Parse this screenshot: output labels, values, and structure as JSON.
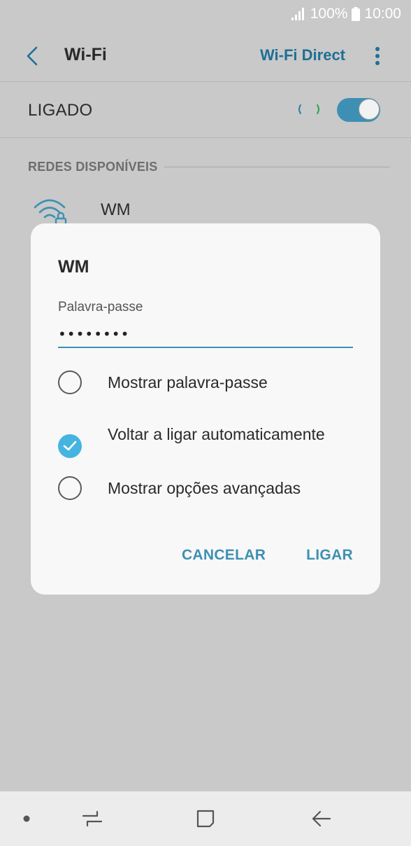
{
  "status_bar": {
    "battery": "100%",
    "time": "10:00",
    "icons": [
      "signal-icon",
      "battery-icon"
    ]
  },
  "header": {
    "title": "Wi-Fi",
    "wifi_direct_label": "Wi-Fi Direct",
    "icons": [
      "back-arrow-icon",
      "more-vertical-icon"
    ]
  },
  "wifi_switch": {
    "label": "LIGADO",
    "enabled": true
  },
  "networks": {
    "section_title": "REDES DISPONÍVEIS",
    "items": [
      {
        "name": "WM",
        "icon": "wifi-lock-icon"
      }
    ]
  },
  "dialog": {
    "title": "WM",
    "password_label": "Palavra-passe",
    "password_value": "••••••••",
    "options": [
      {
        "label": "Mostrar palavra-passe",
        "checked": false
      },
      {
        "label": "Voltar a ligar automaticamente",
        "checked": true
      },
      {
        "label": "Mostrar opções avançadas",
        "checked": false
      }
    ],
    "cancel_label": "CANCELAR",
    "confirm_label": "LIGAR"
  },
  "colors": {
    "accent": "#3d90b3",
    "check": "#46b4e0",
    "scrim": "#c9c9c9",
    "dialog_bg": "#f8f8f8"
  },
  "nav_bar": {
    "icons": [
      "dot-icon",
      "recent-apps-icon",
      "home-icon",
      "back-icon"
    ]
  }
}
